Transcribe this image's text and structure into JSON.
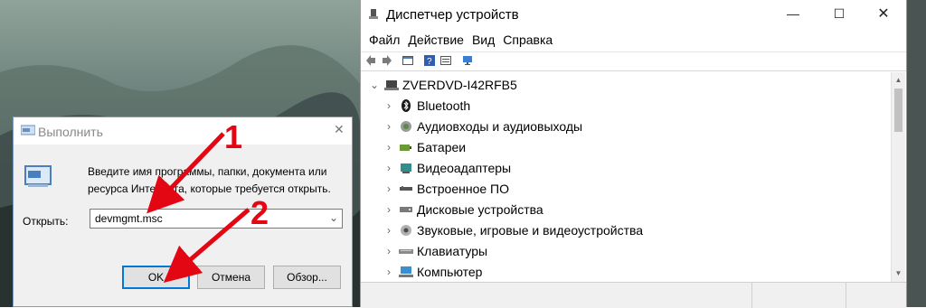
{
  "device_manager": {
    "title": "Диспетчер устройств",
    "window_buttons": {
      "minimize": "—",
      "maximize": "☐",
      "close": "✕"
    },
    "menu": [
      "Файл",
      "Действие",
      "Вид",
      "Справка"
    ],
    "toolbar_icons": [
      "back-icon",
      "forward-icon",
      "properties-icon",
      "help-icon",
      "view-icon",
      "monitor-icon"
    ],
    "tree": {
      "root": "ZVERDVD-I42RFB5",
      "root_chevron": "⌄",
      "item_chevron": "›",
      "items": [
        {
          "label": "Bluetooth",
          "icon": "bluetooth-icon"
        },
        {
          "label": "Аудиовходы и аудиовыходы",
          "icon": "audio-icon"
        },
        {
          "label": "Батареи",
          "icon": "battery-icon"
        },
        {
          "label": "Видеоадаптеры",
          "icon": "display-adapter-icon"
        },
        {
          "label": "Встроенное ПО",
          "icon": "firmware-icon"
        },
        {
          "label": "Дисковые устройства",
          "icon": "disk-drive-icon"
        },
        {
          "label": "Звуковые, игровые и видеоустройства",
          "icon": "sound-icon"
        },
        {
          "label": "Клавиатуры",
          "icon": "keyboard-icon"
        },
        {
          "label": "Компьютер",
          "icon": "computer-icon"
        }
      ]
    },
    "scrollbar": {
      "up": "▲",
      "down": "▼"
    }
  },
  "run_dialog": {
    "title": "Выполнить",
    "close": "✕",
    "description": "Введите имя программы, папки, документа или ресурса Интернета, которые требуется открыть.",
    "open_label": "Открыть:",
    "open_value": "devmgmt.msc",
    "dropdown_arrow": "⌄",
    "buttons": {
      "ok": "OK",
      "cancel": "Отмена",
      "browse": "Обзор..."
    }
  },
  "annotations": {
    "step1": "1",
    "step2": "2"
  },
  "colors": {
    "annotation_red": "#e30613",
    "accent_blue": "#0078d7"
  }
}
